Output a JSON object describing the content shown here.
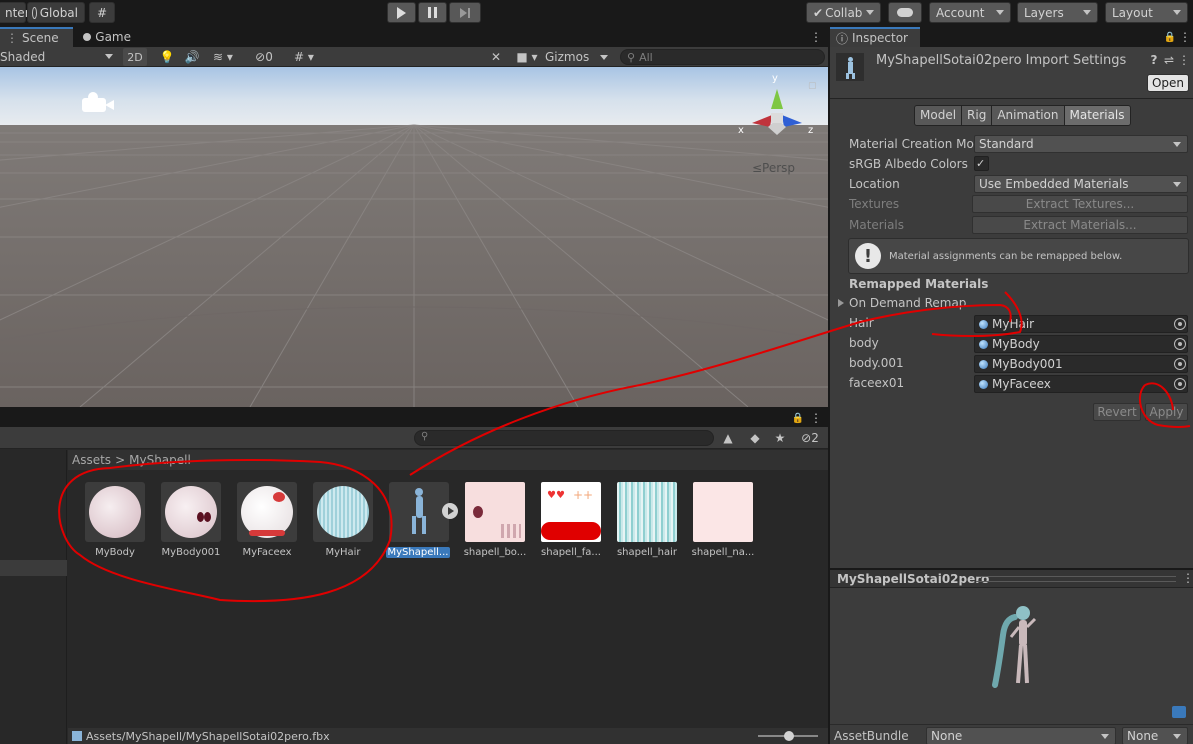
{
  "toolbar": {
    "pivot_label": "nter",
    "global_label": "Global",
    "collab_label": "Collab",
    "account_label": "Account",
    "layers_label": "Layers",
    "layout_label": "Layout"
  },
  "scene": {
    "tab_scene": "Scene",
    "tab_game": "Game",
    "shading_mode": "Shaded",
    "mode_2d": "2D",
    "hidden_count": "0",
    "gizmos_label": "Gizmos",
    "search_placeholder": "All",
    "persp_label": "≤Persp",
    "axis_x": "x",
    "axis_y": "y",
    "axis_z": "z"
  },
  "project": {
    "breadcrumb_root": "Assets",
    "breadcrumb_sep": ">",
    "breadcrumb_folder": "MyShapell",
    "hidden_count": "2",
    "path_bar": "Assets/MyShapell/MyShapellSotai02pero.fbx",
    "assets": [
      {
        "name": "MyBody",
        "kind": "material",
        "color": "#e9d6dd"
      },
      {
        "name": "MyBody001",
        "kind": "material",
        "color": "#eddde2"
      },
      {
        "name": "MyFaceex",
        "kind": "material",
        "color": "#f4f0f2"
      },
      {
        "name": "MyHair",
        "kind": "material",
        "color": "#bfe3ea"
      },
      {
        "name": "MyShapell...",
        "kind": "model",
        "color": "#4a5a70"
      },
      {
        "name": "shapell_bo...",
        "kind": "texture",
        "color": "#f7dede"
      },
      {
        "name": "shapell_fa...",
        "kind": "texture",
        "color": "#ffffff"
      },
      {
        "name": "shapell_hair",
        "kind": "texture",
        "color": "#a8dcdc"
      },
      {
        "name": "shapell_na...",
        "kind": "texture",
        "color": "#fbe6e6"
      }
    ]
  },
  "inspector": {
    "tab_label": "Inspector",
    "title": "MyShapellSotai02pero Import Settings",
    "open_label": "Open",
    "tabs": [
      "Model",
      "Rig",
      "Animation",
      "Materials"
    ],
    "active_tab": "Materials",
    "material_creation_label": "Material Creation Moc",
    "material_creation_value": "Standard",
    "srgb_label": "sRGB Albedo Colors",
    "srgb_checked": "✓",
    "location_label": "Location",
    "location_value": "Use Embedded Materials",
    "textures_label": "Textures",
    "extract_textures": "Extract Textures...",
    "materials_label": "Materials",
    "extract_materials": "Extract Materials...",
    "info_text": "Material assignments can be remapped below.",
    "remapped_header": "Remapped Materials",
    "on_demand_label": "On Demand Remap",
    "remaps": [
      {
        "name": "Hair",
        "material": "MyHair"
      },
      {
        "name": "body",
        "material": "MyBody"
      },
      {
        "name": "body.001",
        "material": "MyBody001"
      },
      {
        "name": "faceex01",
        "material": "MyFaceex"
      }
    ],
    "revert_label": "Revert",
    "apply_label": "Apply",
    "preview_title": "MyShapellSotai02pero",
    "assetbundle_label": "AssetBundle",
    "assetbundle_value": "None",
    "assetbundle_variant": "None"
  },
  "colors": {
    "accent": "#3a79bb",
    "annotation": "#e00000"
  }
}
